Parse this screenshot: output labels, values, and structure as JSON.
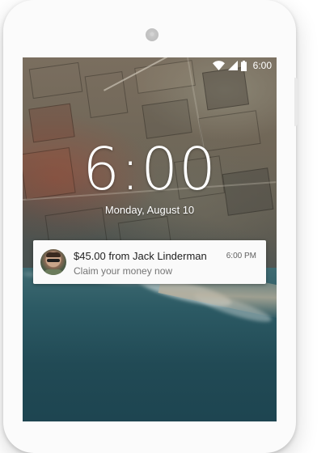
{
  "status_bar": {
    "time": "6:00",
    "icons": [
      "wifi-icon",
      "cellular-signal-icon",
      "battery-icon"
    ]
  },
  "lockscreen": {
    "clock": "6:00",
    "date": "Monday, August 10"
  },
  "notification": {
    "avatar_icon": "contact-avatar",
    "title": "$45.00 from Jack Linderman",
    "body": "Claim your money now",
    "time": "6:00 PM"
  }
}
